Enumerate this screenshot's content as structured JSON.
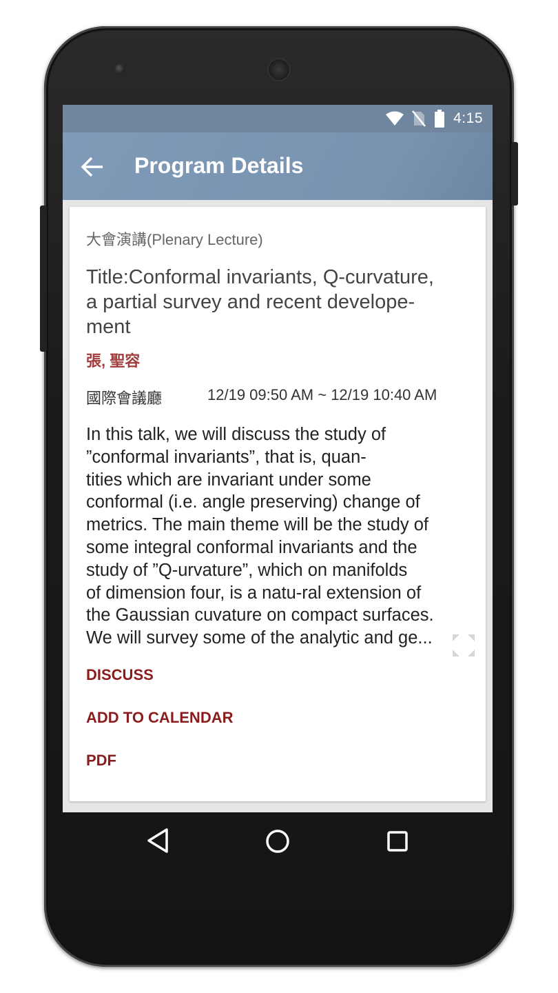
{
  "status_bar": {
    "time": "4:15"
  },
  "app_bar": {
    "title": "Program Details"
  },
  "program": {
    "category": "大會演講(Plenary Lecture)",
    "title_lines": [
      "Title:Conformal invariants, Q-curvature,",
      "a partial survey and recent develope-",
      "ment"
    ],
    "speaker": "張, 聖容",
    "venue": "國際會議廳",
    "time": "12/19 09:50 AM ~ 12/19 10:40 AM",
    "abstract_lines": [
      "In this talk, we will discuss the study of",
      "”conformal invariants”, that is, quan-",
      "tities which are invariant under some",
      "conformal (i.e. angle preserving) change of",
      "metrics. The main theme will be the study of",
      "some integral conformal invariants and the",
      "study of ”Q-urvature”, which on manifolds",
      "of dimension four, is a natu-ral extension of",
      "the Gaussian cuvature on compact surfaces.",
      "We will survey some of the analytic and  ge..."
    ]
  },
  "actions": {
    "discuss": "DISCUSS",
    "add_to_calendar": "ADD TO CALENDAR",
    "pdf": "PDF"
  },
  "colors": {
    "app_bar": "#7f9bb8",
    "status_bar": "#70869f",
    "accent": "#8b1c1c",
    "speaker": "#a23b3b"
  }
}
